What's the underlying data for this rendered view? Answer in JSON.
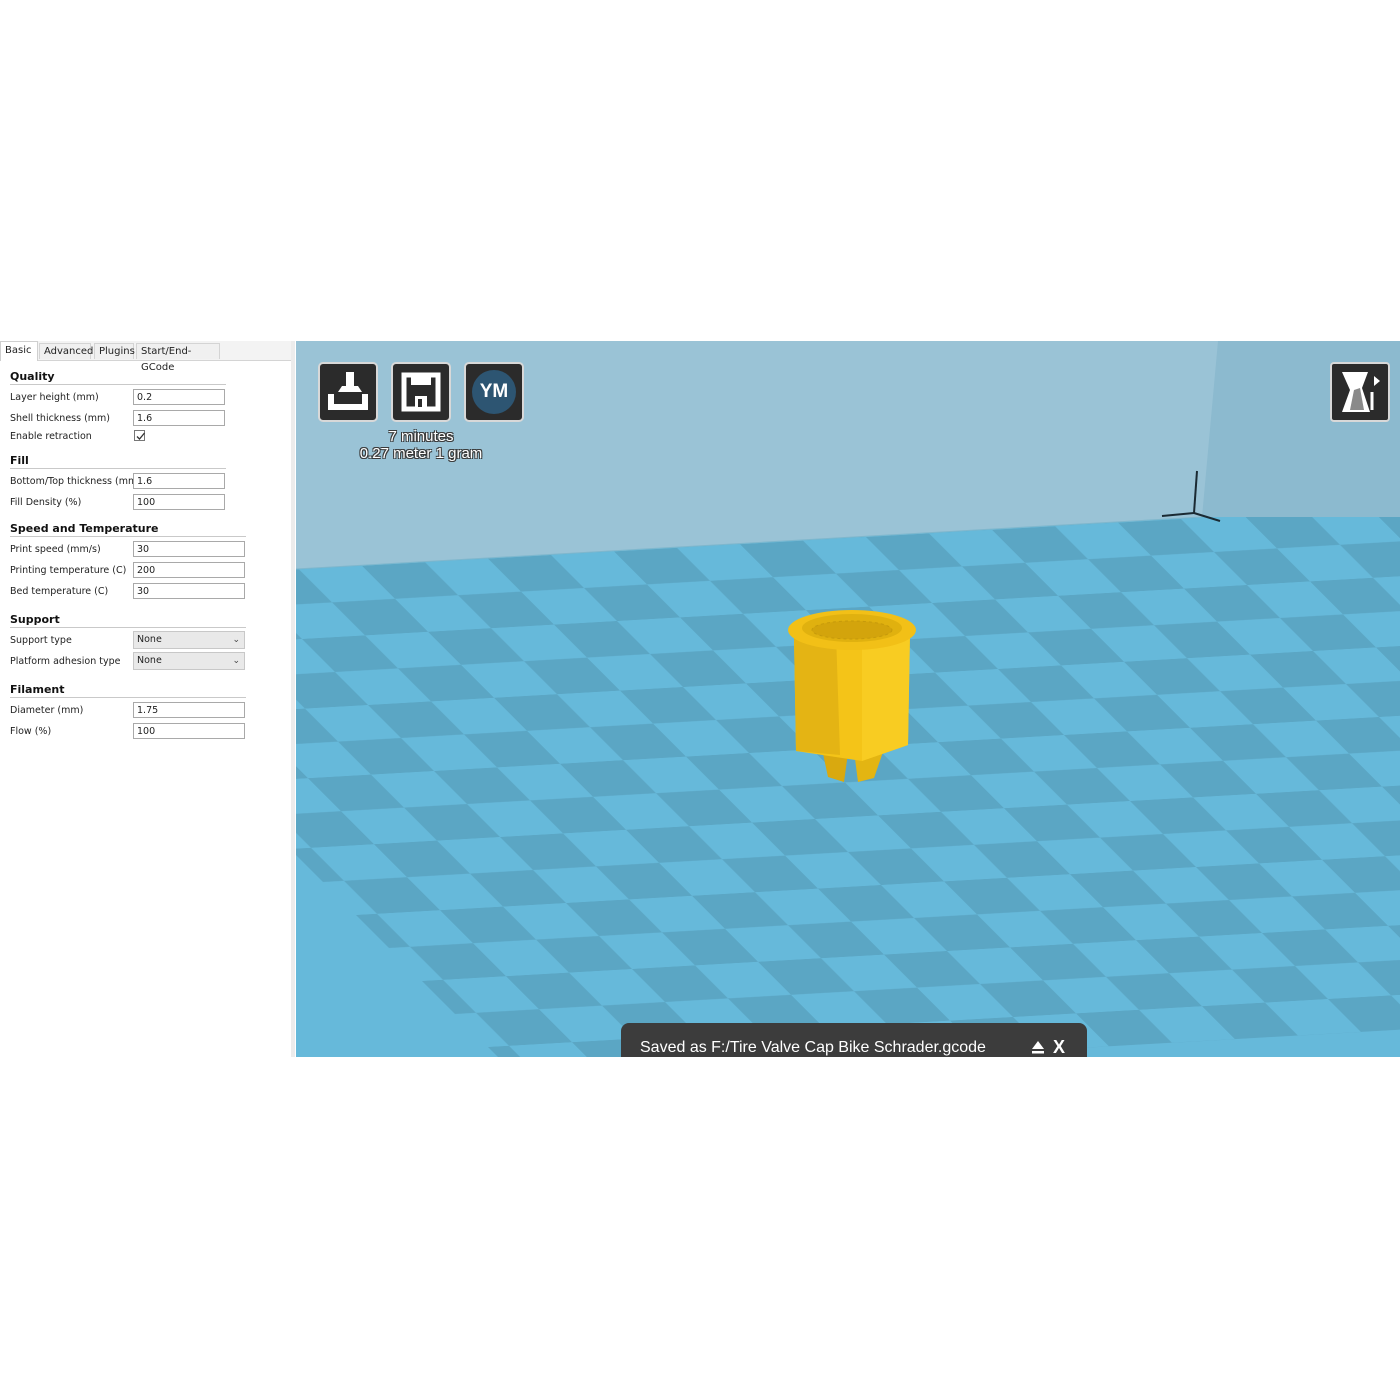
{
  "tabs": [
    {
      "label": "Basic"
    },
    {
      "label": "Advanced"
    },
    {
      "label": "Plugins"
    },
    {
      "label": "Start/End-GCode"
    }
  ],
  "quality": {
    "title": "Quality",
    "layer_height": {
      "label": "Layer height (mm)",
      "value": "0.2"
    },
    "shell_thickness": {
      "label": "Shell thickness (mm)",
      "value": "1.6"
    },
    "enable_retraction": {
      "label": "Enable retraction",
      "checked": true
    }
  },
  "fill": {
    "title": "Fill",
    "bottom_top_thickness": {
      "label": "Bottom/Top thickness (mm)",
      "value": "1.6"
    },
    "fill_density": {
      "label": "Fill Density (%)",
      "value": "100"
    }
  },
  "speed": {
    "title": "Speed and Temperature",
    "print_speed": {
      "label": "Print speed (mm/s)",
      "value": "30"
    },
    "printing_temperature": {
      "label": "Printing temperature (C)",
      "value": "200"
    },
    "bed_temperature": {
      "label": "Bed temperature (C)",
      "value": "30"
    }
  },
  "support": {
    "title": "Support",
    "support_type": {
      "label": "Support type",
      "value": "None"
    },
    "platform_adhesion": {
      "label": "Platform adhesion type",
      "value": "None"
    }
  },
  "filament": {
    "title": "Filament",
    "diameter": {
      "label": "Diameter (mm)",
      "value": "1.75"
    },
    "flow": {
      "label": "Flow (%)",
      "value": "100"
    }
  },
  "viewport": {
    "ym_label": "YM",
    "print_time": "7 minutes",
    "print_material": "0.27 meter 1 gram",
    "status_message": "Saved as F:/Tire Valve Cap  Bike  Schrader.gcode",
    "close_label": "X"
  },
  "colors": {
    "back_wall": "#9ac3d6",
    "checker_light": "#66b9da",
    "checker_dark": "#5ba6c4",
    "model": "#f4c418",
    "button_bg": "#2b2b2b",
    "status_bg": "#3c3c3c"
  },
  "icons": [
    "load-model-icon",
    "save-icon",
    "view-mode-icon",
    "eject-icon",
    "checkmark-icon",
    "chevron-down-icon"
  ]
}
